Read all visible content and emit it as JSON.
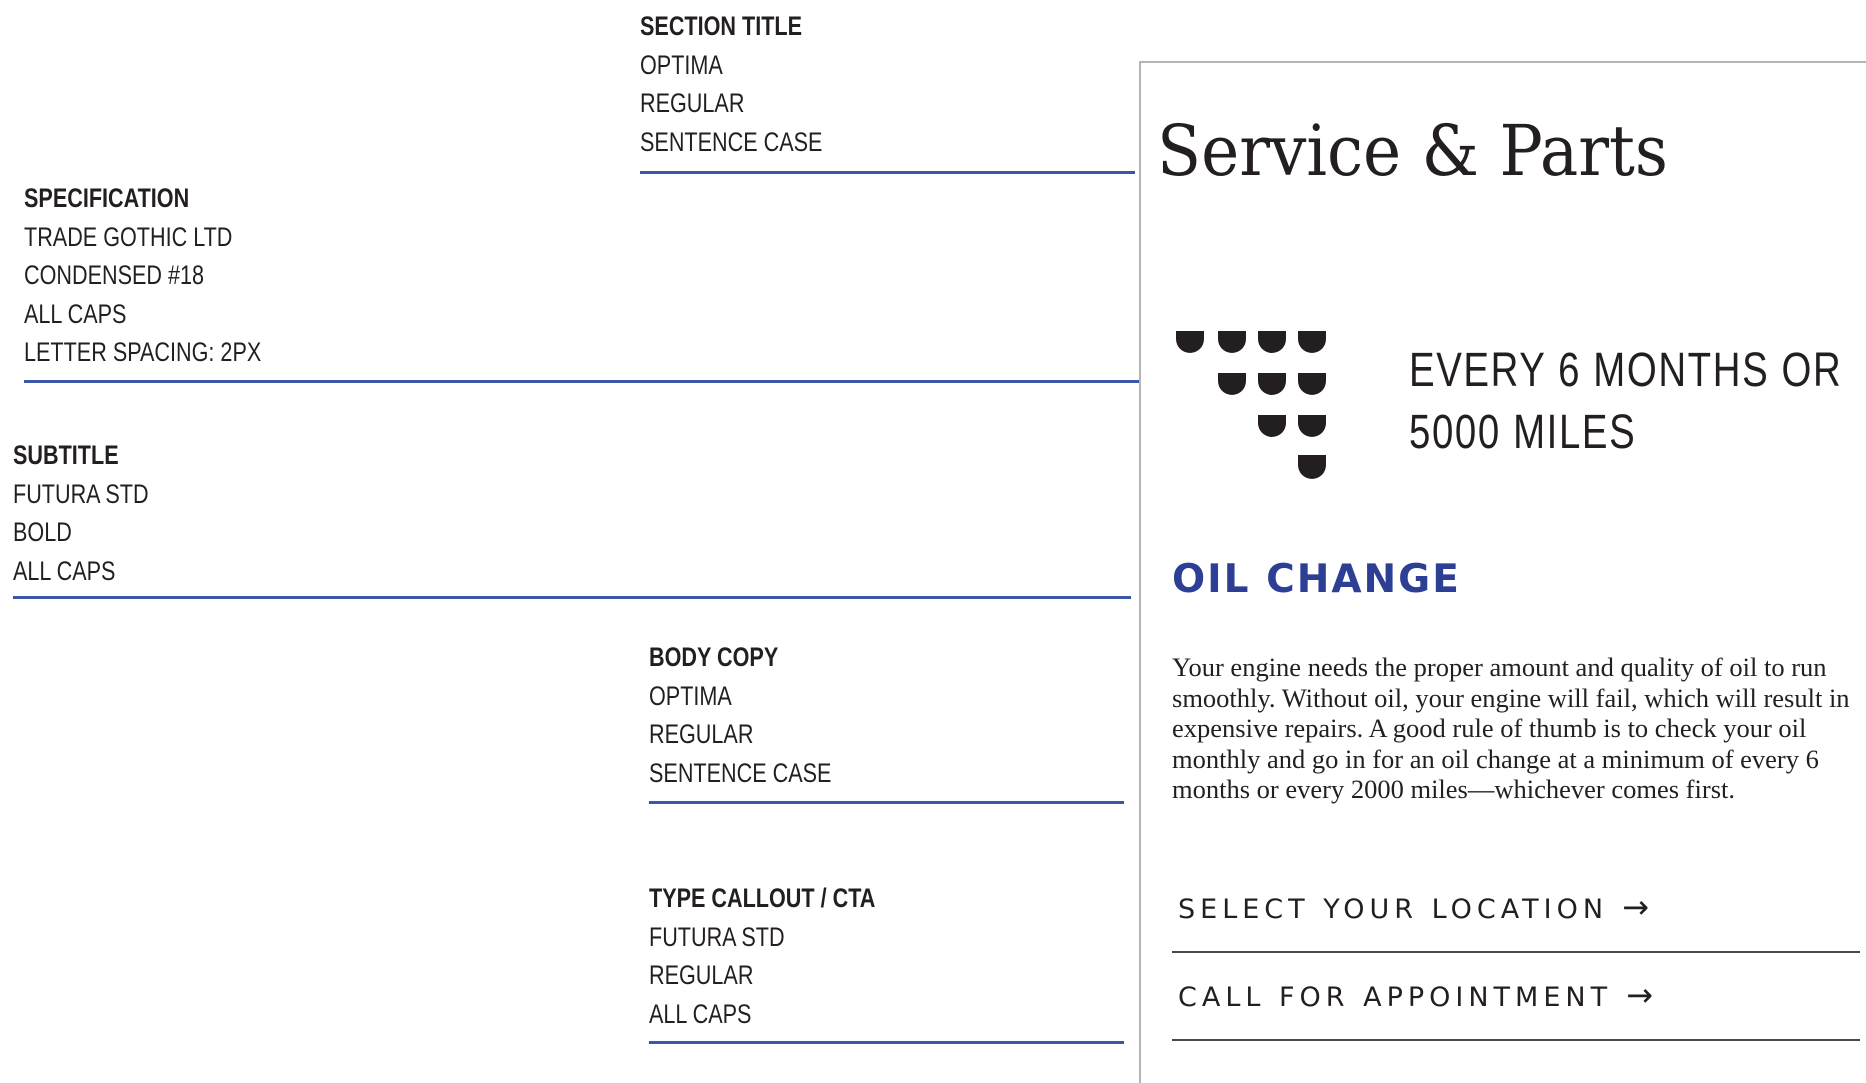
{
  "annotations": {
    "section_title": {
      "heading": "SECTION TITLE",
      "lines": [
        "OPTIMA",
        "REGULAR",
        "SENTENCE CASE"
      ]
    },
    "specification": {
      "heading": "SPECIFICATION",
      "lines": [
        "TRADE GOTHIC LTD",
        "CONDENSED #18",
        "ALL CAPS",
        "LETTER SPACING: 2PX"
      ]
    },
    "subtitle": {
      "heading": "SUBTITLE",
      "lines": [
        "FUTURA STD",
        "BOLD",
        "ALL CAPS"
      ]
    },
    "body_copy": {
      "heading": "BODY COPY",
      "lines": [
        "OPTIMA",
        "REGULAR",
        "SENTENCE CASE"
      ]
    },
    "type_callout": {
      "heading": "TYPE CALLOUT / CTA",
      "lines": [
        "FUTURA STD",
        "REGULAR",
        "ALL CAPS"
      ]
    }
  },
  "sample": {
    "section_title": "Service & Parts",
    "spec_lines": [
      "EVERY 6 MONTHS OR",
      "5000 MILES"
    ],
    "subtitle": "OIL CHANGE",
    "body": "Your engine needs the proper amount and quality of oil to run smoothly. Without oil, your engine will fail, which will result in expensive repairs. A good rule of thumb is to check your oil monthly and go in for an oil change at a minimum of every 6 months or every 2000 miles—whichever comes first.",
    "cta_location": "SELECT YOUR LOCATION",
    "cta_appointment": "CALL FOR APPOINTMENT",
    "cta_arrow": "→"
  },
  "icons": {
    "logo": "oil-drops-logo-icon",
    "arrow": "arrow-right-icon"
  },
  "colors": {
    "accent_blue": "#2d3f94",
    "rule_blue": "#3b56a6",
    "text": "#231f20",
    "panel_border": "#b5b5b5"
  }
}
